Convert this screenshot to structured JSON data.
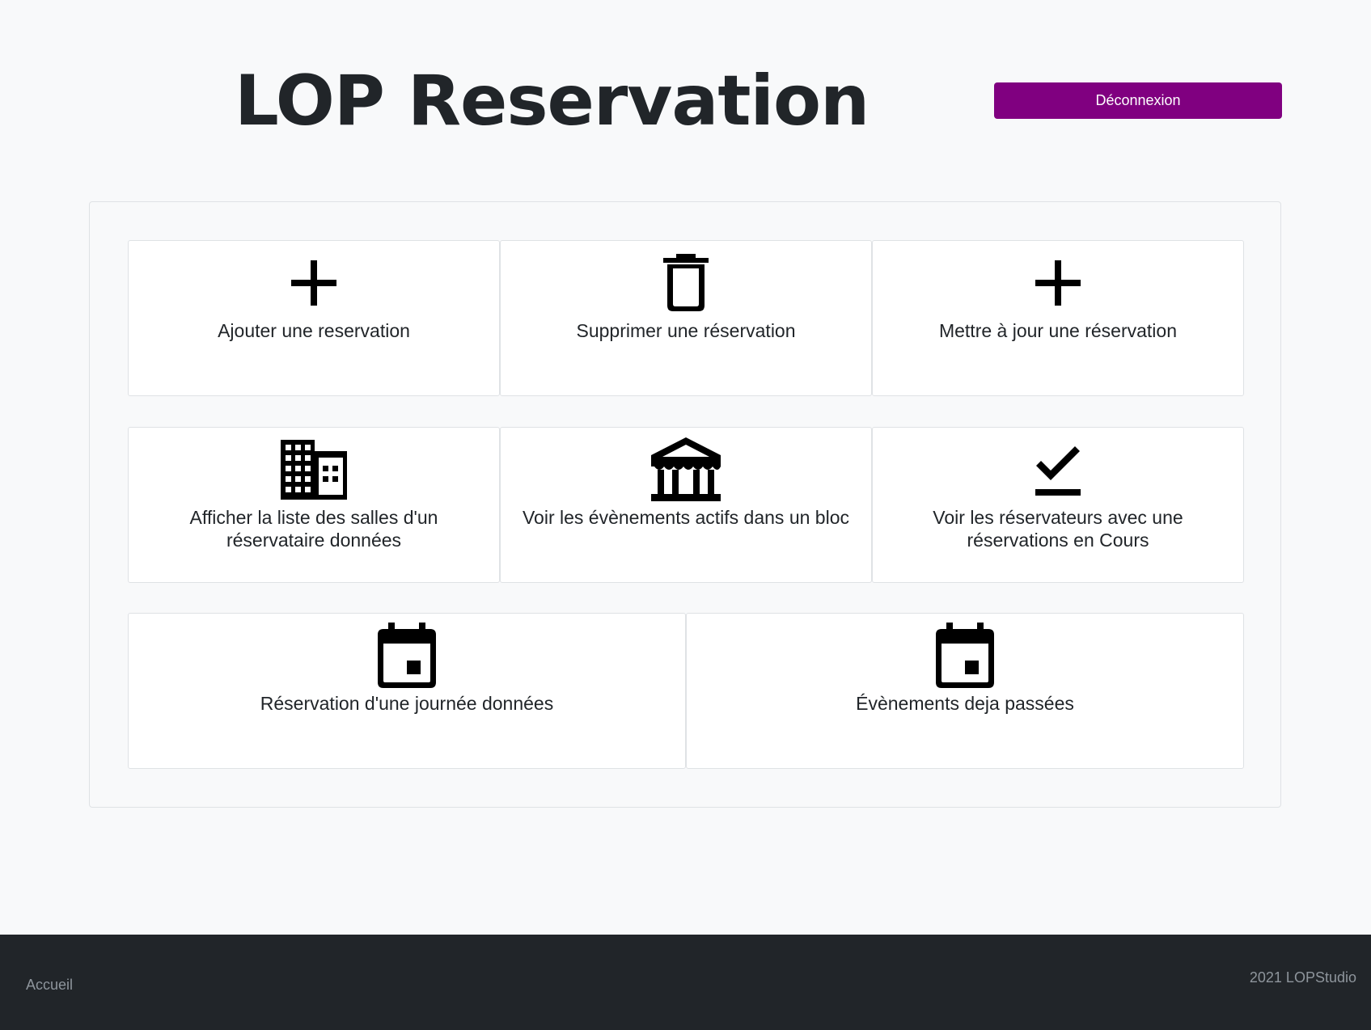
{
  "header": {
    "title": "LOP Reservation",
    "logout_label": "Déconnexion"
  },
  "colors": {
    "accent": "#800080",
    "footer_bg": "#212529",
    "page_bg": "#f8f9fa"
  },
  "cards": [
    {
      "label": "Ajouter une reservation",
      "icon": "plus-icon"
    },
    {
      "label": "Supprimer une réservation",
      "icon": "trash-icon"
    },
    {
      "label": "Mettre à jour une réservation",
      "icon": "plus-icon"
    },
    {
      "label": "Afficher la liste des salles d'un réservataire données",
      "icon": "building-icon"
    },
    {
      "label": "Voir les évènements actifs dans un bloc",
      "icon": "museum-icon"
    },
    {
      "label": "Voir les réservateurs avec une réservations en Cours",
      "icon": "check-icon"
    },
    {
      "label": "Réservation d'une journée données",
      "icon": "calendar-icon"
    },
    {
      "label": "Évènements deja passées",
      "icon": "calendar-icon"
    }
  ],
  "footer": {
    "link_label": "Accueil",
    "copyright": "2021 LOPStudio"
  }
}
